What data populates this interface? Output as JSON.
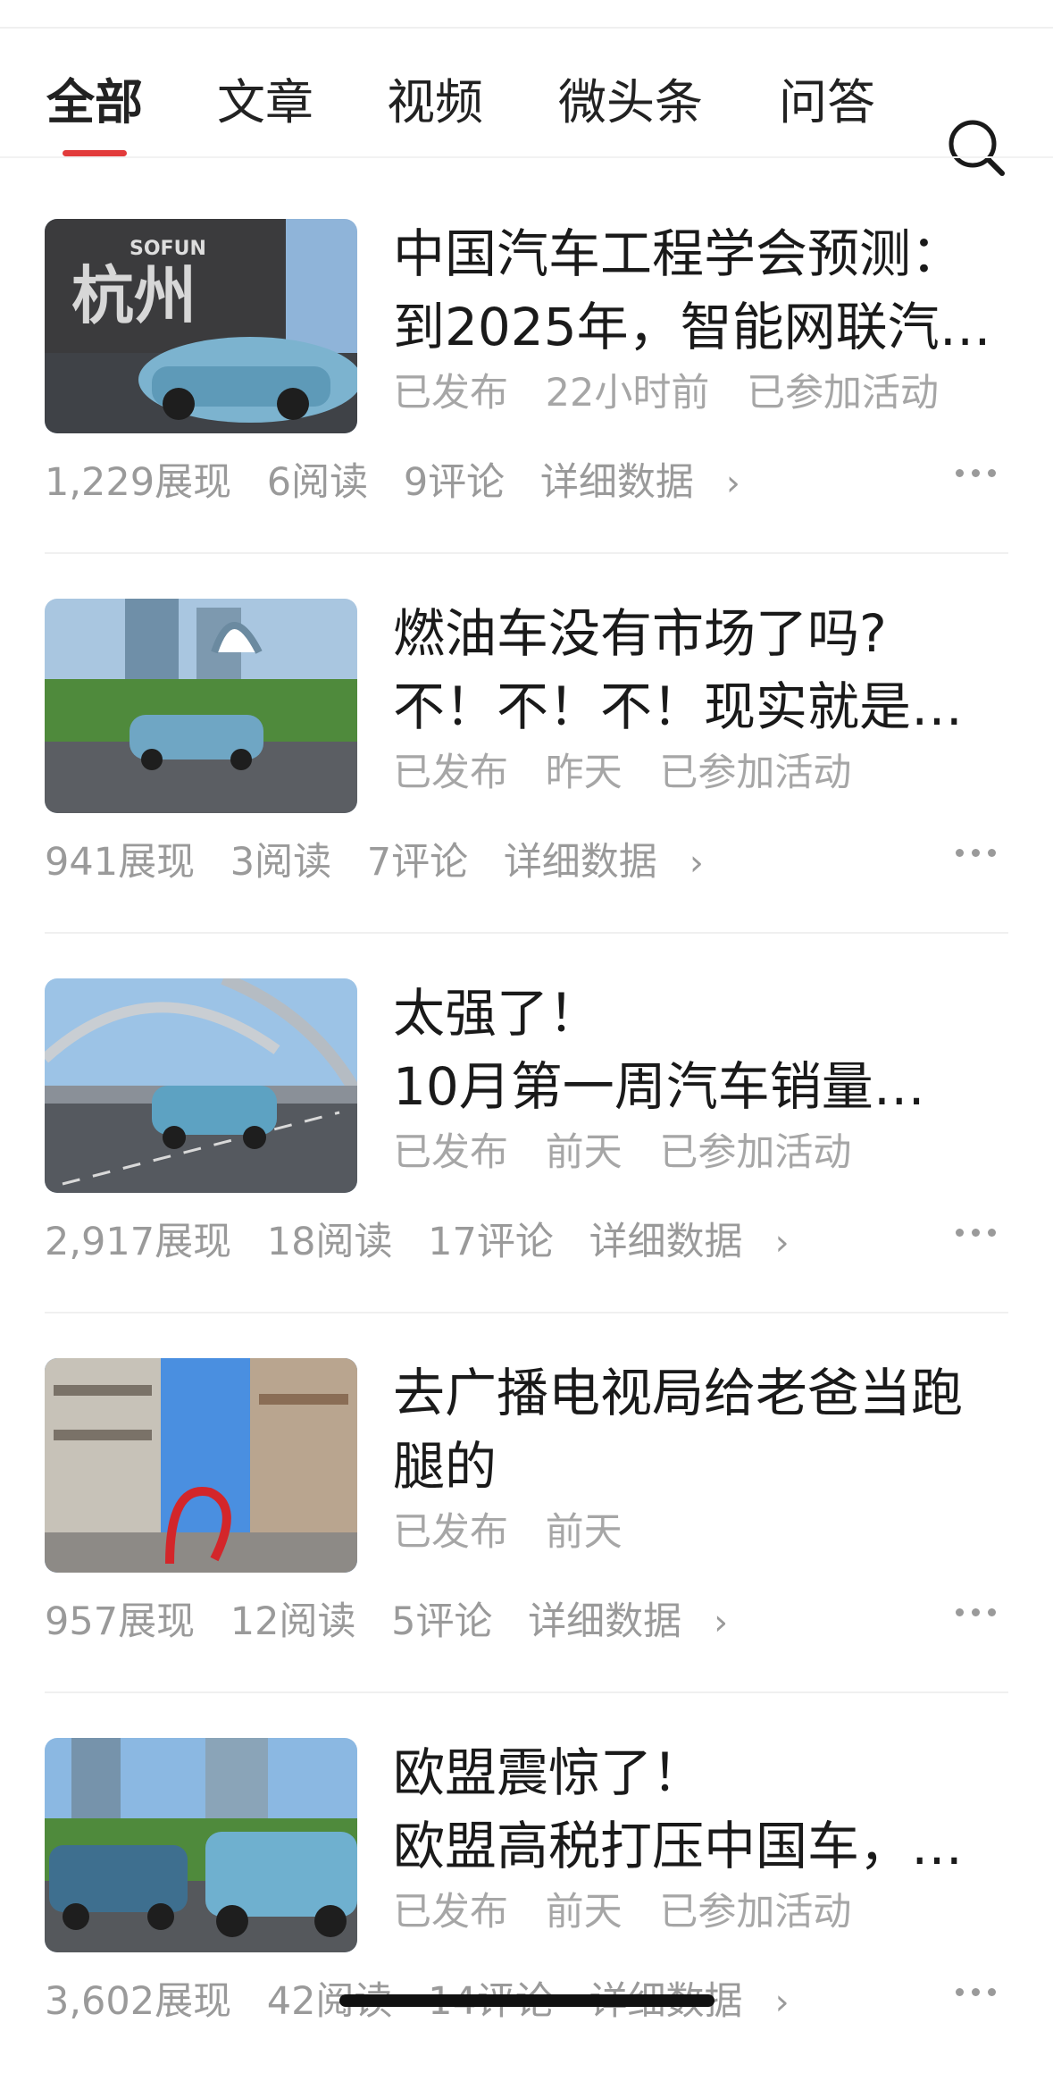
{
  "tabs": [
    {
      "label": "全部",
      "active": true
    },
    {
      "label": "文章",
      "active": false
    },
    {
      "label": "视频",
      "active": false
    },
    {
      "label": "微头条",
      "active": false
    },
    {
      "label": "问答",
      "active": false
    }
  ],
  "search_icon": "search-icon",
  "accent_color": "#e23b3b",
  "items": [
    {
      "title_line1": "中国汽车工程学会预测：",
      "title_line2": "到2025年，智能网联汽…",
      "status": "已发布",
      "time": "22小时前",
      "activity": "已参加活动",
      "impressions": "1,229展现",
      "reads": "6阅读",
      "comments": "9评论",
      "detail": "详细数据",
      "thumb_text": "杭州",
      "thumb_brand": "SOFUN"
    },
    {
      "title_line1": "燃油车没有市场了吗?",
      "title_line2": "不！不！不！现实就是…",
      "status": "已发布",
      "time": "昨天",
      "activity": "已参加活动",
      "impressions": "941展现",
      "reads": "3阅读",
      "comments": "7评论",
      "detail": "详细数据"
    },
    {
      "title_line1": "太强了！",
      "title_line2": "10月第一周汽车销量…",
      "status": "已发布",
      "time": "前天",
      "activity": "已参加活动",
      "impressions": "2,917展现",
      "reads": "18阅读",
      "comments": "17评论",
      "detail": "详细数据"
    },
    {
      "title_line1": "去广播电视局给老爸当跑",
      "title_line2": "腿的",
      "status": "已发布",
      "time": "前天",
      "activity": "",
      "impressions": "957展现",
      "reads": "12阅读",
      "comments": "5评论",
      "detail": "详细数据"
    },
    {
      "title_line1": "欧盟震惊了！",
      "title_line2": "欧盟高税打压中国车，…",
      "status": "已发布",
      "time": "前天",
      "activity": "已参加活动",
      "impressions": "3,602展现",
      "reads": "42阅读",
      "comments": "14评论",
      "detail": "详细数据"
    }
  ]
}
